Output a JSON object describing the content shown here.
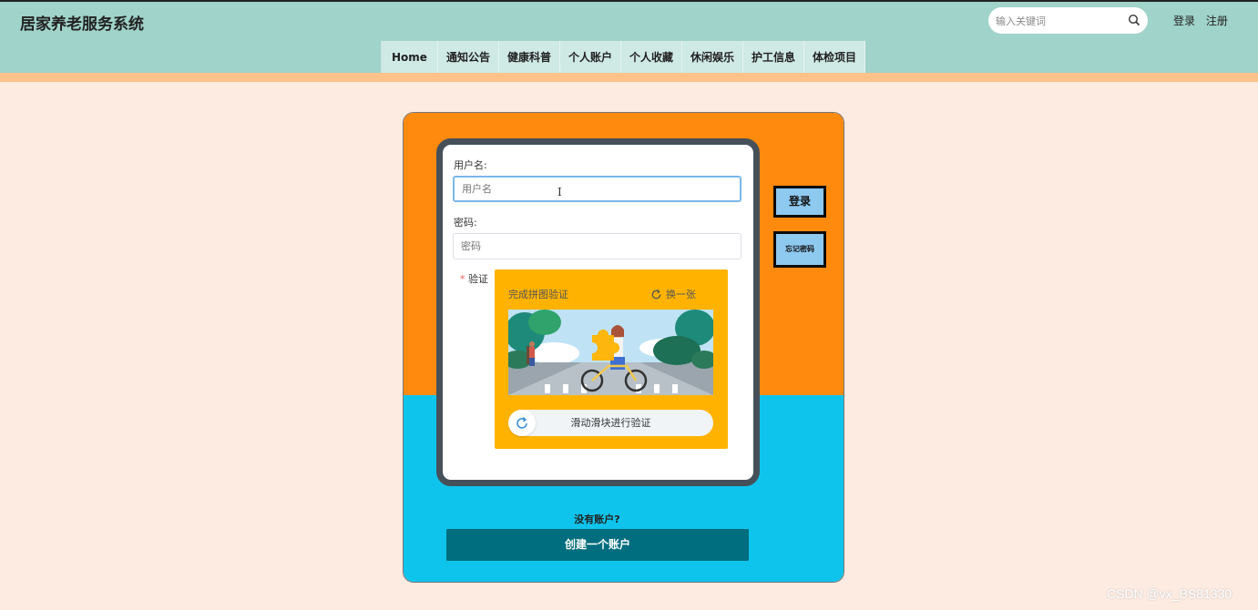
{
  "header": {
    "title": "居家养老服务系统",
    "search_placeholder": "输入关键词",
    "login_link": "登录",
    "register_link": "注册"
  },
  "nav": {
    "items": [
      "Home",
      "通知公告",
      "健康科普",
      "个人账户",
      "个人收藏",
      "休闲娱乐",
      "护工信息",
      "体检项目"
    ]
  },
  "form": {
    "username_label": "用户名:",
    "username_placeholder": "用户名",
    "password_label": "密码:",
    "password_placeholder": "密码",
    "verify_required_mark": "*",
    "verify_label": "验证",
    "captcha_title": "完成拼图验证",
    "captcha_refresh": "换一张",
    "slider_text": "滑动滑块进行验证"
  },
  "side": {
    "login_button": "登录",
    "forgot_button": "忘记密码"
  },
  "footer": {
    "no_account": "没有账户?",
    "create_account": "创建一个账户"
  },
  "watermark": "CSDN @vx_BS81330",
  "colors": {
    "header_bg": "#a0d3c9",
    "card_top": "#ff8a0e",
    "card_bottom": "#0fc4ec",
    "captcha_bg": "#ffb300",
    "create_btn": "#006e7e",
    "side_btn": "#8ec9ef"
  }
}
